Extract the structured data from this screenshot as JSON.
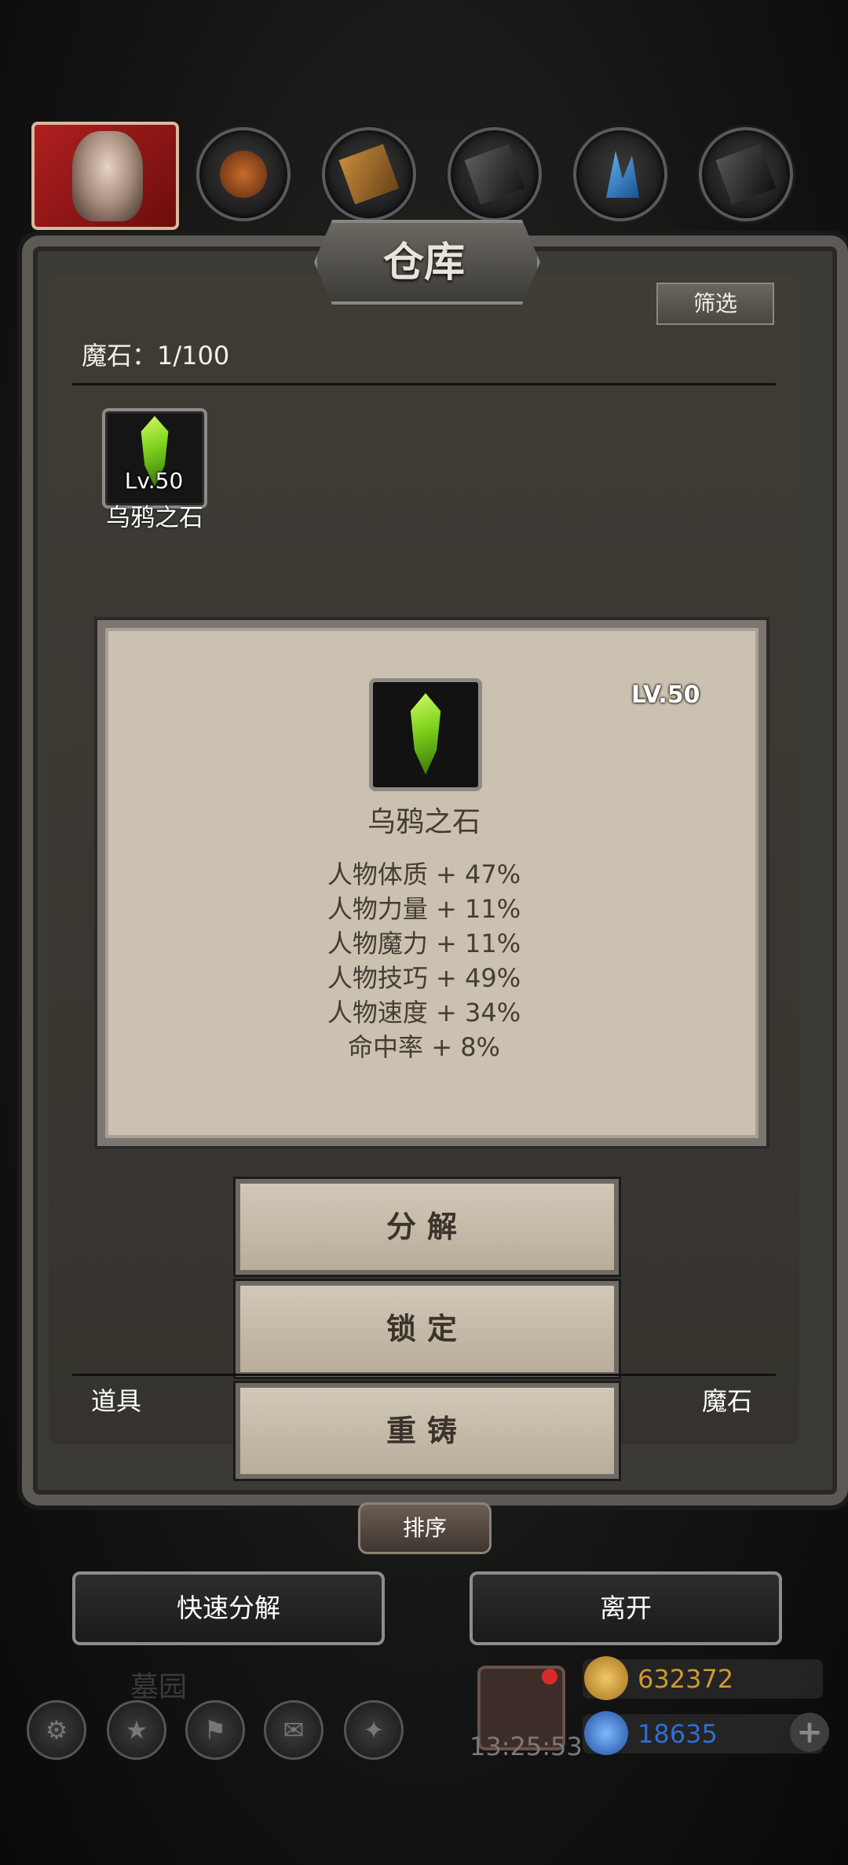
{
  "window": {
    "title": "仓库",
    "filter_label": "筛选"
  },
  "inventory": {
    "category_count_label": "魔石：1/100",
    "items": [
      {
        "level": "Lv.50",
        "name": "乌鸦之石"
      }
    ]
  },
  "detail": {
    "level": "LV.50",
    "name": "乌鸦之石",
    "stats": [
      "人物体质 + 47%",
      "人物力量 + 11%",
      "人物魔力 + 11%",
      "人物技巧 + 49%",
      "人物速度 + 34%",
      "命中率 + 8%"
    ]
  },
  "actions": {
    "decompose": "分解",
    "lock": "锁定",
    "reforge": "重铸"
  },
  "tabs": {
    "items": "道具",
    "magic_stones": "魔石"
  },
  "sort_label": "排序",
  "footer": {
    "quick_decompose": "快速分解",
    "leave": "离开"
  },
  "hud": {
    "zone": "墓园",
    "clock": "13:25:53",
    "gold": "632372",
    "gems": "18635",
    "colors": {
      "gold": "#d19a2e",
      "gem": "#2f6fd1"
    }
  }
}
